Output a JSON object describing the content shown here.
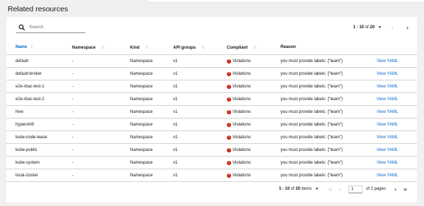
{
  "title": "Related resources",
  "search": {
    "placeholder": "Search",
    "value": ""
  },
  "pagination_top": {
    "range": "1 - 10",
    "of_label": "of",
    "total": "20"
  },
  "columns": [
    {
      "label": "Name",
      "sorted": true
    },
    {
      "label": "Namespace",
      "sorted": false
    },
    {
      "label": "Kind",
      "sorted": false
    },
    {
      "label": "API groups",
      "sorted": false
    },
    {
      "label": "Compliant",
      "sorted": false
    },
    {
      "label": "Reason",
      "sorted": false
    },
    {
      "label": "",
      "sorted": false
    }
  ],
  "rows": [
    {
      "name": "default",
      "namespace": "-",
      "kind": "Namespace",
      "api_groups": "v1",
      "compliant": "Violations",
      "reason": "you must provide labels: {\"team\"}",
      "action": "View YAML"
    },
    {
      "name": "default-broker",
      "namespace": "-",
      "kind": "Namespace",
      "api_groups": "v1",
      "compliant": "Violations",
      "reason": "you must provide labels: {\"team\"}",
      "action": "View YAML"
    },
    {
      "name": "e2e-rbac-test-1",
      "namespace": "-",
      "kind": "Namespace",
      "api_groups": "v1",
      "compliant": "Violations",
      "reason": "you must provide labels: {\"team\"}",
      "action": "View YAML"
    },
    {
      "name": "e2e-rbac-test-2",
      "namespace": "-",
      "kind": "Namespace",
      "api_groups": "v1",
      "compliant": "Violations",
      "reason": "you must provide labels: {\"team\"}",
      "action": "View YAML"
    },
    {
      "name": "hive",
      "namespace": "-",
      "kind": "Namespace",
      "api_groups": "v1",
      "compliant": "Violations",
      "reason": "you must provide labels: {\"team\"}",
      "action": "View YAML"
    },
    {
      "name": "hypershift",
      "namespace": "-",
      "kind": "Namespace",
      "api_groups": "v1",
      "compliant": "Violations",
      "reason": "you must provide labels: {\"team\"}",
      "action": "View YAML"
    },
    {
      "name": "kube-node-lease",
      "namespace": "-",
      "kind": "Namespace",
      "api_groups": "v1",
      "compliant": "Violations",
      "reason": "you must provide labels: {\"team\"}",
      "action": "View YAML"
    },
    {
      "name": "kube-public",
      "namespace": "-",
      "kind": "Namespace",
      "api_groups": "v1",
      "compliant": "Violations",
      "reason": "you must provide labels: {\"team\"}",
      "action": "View YAML"
    },
    {
      "name": "kube-system",
      "namespace": "-",
      "kind": "Namespace",
      "api_groups": "v1",
      "compliant": "Violations",
      "reason": "you must provide labels: {\"team\"}",
      "action": "View YAML"
    },
    {
      "name": "local-cluster",
      "namespace": "-",
      "kind": "Namespace",
      "api_groups": "v1",
      "compliant": "Violations",
      "reason": "you must provide labels: {\"team\"}",
      "action": "View YAML"
    }
  ],
  "pagination_bottom": {
    "range": "1 - 10",
    "of_label": "of",
    "total": "20",
    "items_label": "items",
    "page_value": "1",
    "of_pages": "of 2 pages"
  },
  "colors": {
    "link": "#0066cc",
    "danger": "#c9190b",
    "border": "#d2d2d2"
  },
  "icons": {
    "search": "search-icon",
    "sort_up": "arrow-up-icon",
    "sort": "sort-icon",
    "violation": "exclamation-circle-icon"
  }
}
